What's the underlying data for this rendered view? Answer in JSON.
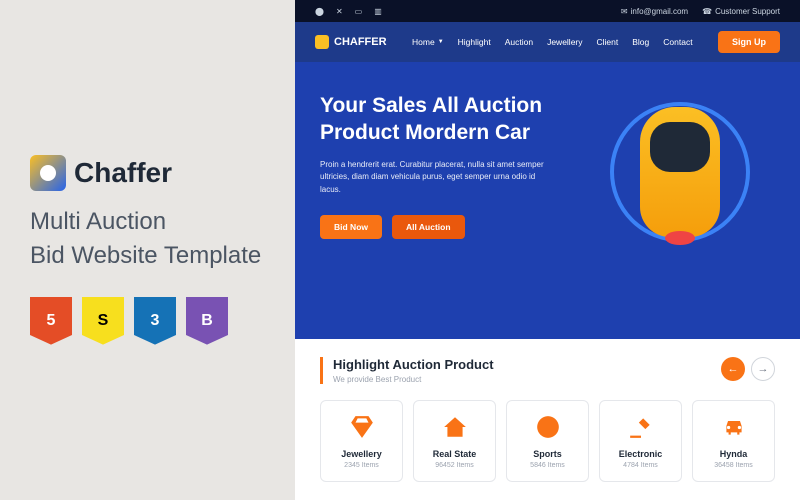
{
  "promo": {
    "brand": "Chaffer",
    "title": "Multi Auction\nBid Website Template"
  },
  "topbar": {
    "email": "info@gmail.com",
    "support": "Customer Support"
  },
  "nav": {
    "brand": "CHAFFER",
    "links": [
      "Home",
      "Highlight",
      "Auction",
      "Jewellery",
      "Client",
      "Blog",
      "Contact"
    ],
    "signup": "Sign Up"
  },
  "hero": {
    "title": "Your Sales All Auction Product Mordern Car",
    "desc": "Proin a hendrerit erat. Curabitur placerat, nulla sit amet semper ultricies, diam diam vehicula purus, eget semper urna odio id lacus.",
    "bid_now": "Bid Now",
    "all_auction": "All Auction"
  },
  "highlight": {
    "title": "Highlight Auction Product",
    "subtitle": "We provide Best Product",
    "cards": [
      {
        "name": "Jewellery",
        "count": "2345 Items"
      },
      {
        "name": "Real State",
        "count": "96452 Items"
      },
      {
        "name": "Sports",
        "count": "5846 Items"
      },
      {
        "name": "Electronic",
        "count": "4784 Items"
      },
      {
        "name": "Hynda",
        "count": "36458 Items"
      }
    ]
  }
}
